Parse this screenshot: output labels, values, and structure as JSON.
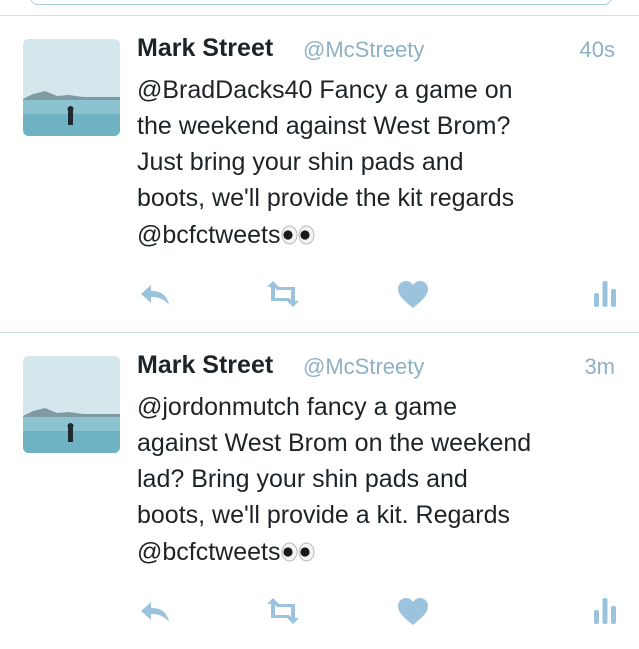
{
  "colors": {
    "icon": "#9cc3dd",
    "divider": "#cfe2ec",
    "text": "#1d2326",
    "meta": "#8fb1c4"
  },
  "icons": {
    "reply": "reply-icon",
    "retweet": "retweet-icon",
    "like": "heart-icon",
    "stats": "analytics-icon",
    "eyes": "eyes-emoji"
  },
  "tweets": [
    {
      "name": "Mark Street",
      "handle": "@McStreety",
      "time": "40s",
      "lines": [
        "@BradDacks40 Fancy a game on",
        "the weekend against West Brom?",
        "Just bring your shin pads and",
        "boots, we'll provide the kit regards"
      ],
      "mention": "@bcfctweets"
    },
    {
      "name": "Mark Street",
      "handle": "@McStreety",
      "time": "3m",
      "lines": [
        "@jordonmutch fancy a game",
        "against West Brom on the weekend",
        "lad? Bring your shin pads and",
        "boots, we'll provide a kit. Regards"
      ],
      "mention": "@bcfctweets"
    }
  ]
}
